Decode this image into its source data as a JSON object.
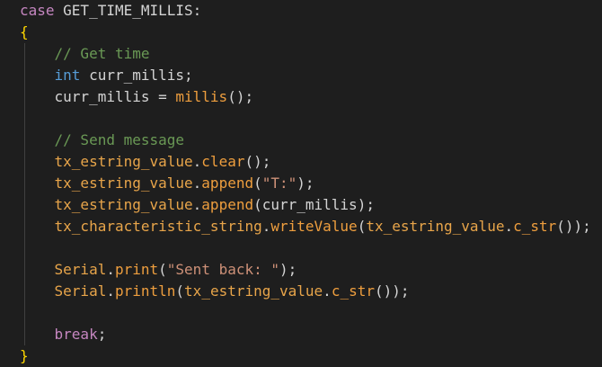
{
  "colors": {
    "background": "#1e1e1e",
    "keyword": "#569cd6",
    "control_keyword": "#c586c0",
    "variable": "#9cdcfe",
    "member_variable": "#e8a54a",
    "function": "#dcdcaa",
    "orange_function": "#ee9e3e",
    "string": "#ce9178",
    "comment": "#6a9955",
    "punctuation": "#d4d4d4",
    "brace": "#ffd700",
    "paren": "#da70d6",
    "indent_guide": "#404040"
  },
  "code": {
    "lines": [
      {
        "tokens": [
          {
            "text": "case",
            "kind": "control_keyword"
          },
          {
            "text": " GET_TIME_MILLIS:",
            "kind": "punctuation"
          }
        ]
      },
      {
        "tokens": [
          {
            "text": "{",
            "kind": "brace"
          }
        ]
      },
      {
        "tokens": [
          {
            "text": "    ",
            "kind": "punctuation"
          },
          {
            "text": "// Get time",
            "kind": "comment"
          }
        ]
      },
      {
        "tokens": [
          {
            "text": "    ",
            "kind": "punctuation"
          },
          {
            "text": "int",
            "kind": "keyword"
          },
          {
            "text": " curr_millis;",
            "kind": "punctuation"
          }
        ]
      },
      {
        "tokens": [
          {
            "text": "    curr_millis = ",
            "kind": "punctuation"
          },
          {
            "text": "millis",
            "kind": "orange_function"
          },
          {
            "text": "();",
            "kind": "punctuation"
          }
        ]
      },
      {
        "tokens": []
      },
      {
        "tokens": [
          {
            "text": "    ",
            "kind": "punctuation"
          },
          {
            "text": "// Send message",
            "kind": "comment"
          }
        ]
      },
      {
        "tokens": [
          {
            "text": "    ",
            "kind": "punctuation"
          },
          {
            "text": "tx_estring_value",
            "kind": "member_variable"
          },
          {
            "text": ".",
            "kind": "punctuation"
          },
          {
            "text": "clear",
            "kind": "orange_function"
          },
          {
            "text": "();",
            "kind": "punctuation"
          }
        ]
      },
      {
        "tokens": [
          {
            "text": "    ",
            "kind": "punctuation"
          },
          {
            "text": "tx_estring_value",
            "kind": "member_variable"
          },
          {
            "text": ".",
            "kind": "punctuation"
          },
          {
            "text": "append",
            "kind": "orange_function"
          },
          {
            "text": "(",
            "kind": "punctuation"
          },
          {
            "text": "\"T:\"",
            "kind": "string"
          },
          {
            "text": ");",
            "kind": "punctuation"
          }
        ]
      },
      {
        "tokens": [
          {
            "text": "    ",
            "kind": "punctuation"
          },
          {
            "text": "tx_estring_value",
            "kind": "member_variable"
          },
          {
            "text": ".",
            "kind": "punctuation"
          },
          {
            "text": "append",
            "kind": "orange_function"
          },
          {
            "text": "(curr_millis);",
            "kind": "punctuation"
          }
        ]
      },
      {
        "tokens": [
          {
            "text": "    ",
            "kind": "punctuation"
          },
          {
            "text": "tx_characteristic_string",
            "kind": "member_variable"
          },
          {
            "text": ".",
            "kind": "punctuation"
          },
          {
            "text": "writeValue",
            "kind": "orange_function"
          },
          {
            "text": "(",
            "kind": "punctuation"
          },
          {
            "text": "tx_estring_value",
            "kind": "member_variable"
          },
          {
            "text": ".",
            "kind": "punctuation"
          },
          {
            "text": "c_str",
            "kind": "orange_function"
          },
          {
            "text": "());",
            "kind": "punctuation"
          }
        ]
      },
      {
        "tokens": []
      },
      {
        "tokens": [
          {
            "text": "    ",
            "kind": "punctuation"
          },
          {
            "text": "Serial",
            "kind": "member_variable"
          },
          {
            "text": ".",
            "kind": "punctuation"
          },
          {
            "text": "print",
            "kind": "orange_function"
          },
          {
            "text": "(",
            "kind": "punctuation"
          },
          {
            "text": "\"Sent back: \"",
            "kind": "string"
          },
          {
            "text": ");",
            "kind": "punctuation"
          }
        ]
      },
      {
        "tokens": [
          {
            "text": "    ",
            "kind": "punctuation"
          },
          {
            "text": "Serial",
            "kind": "member_variable"
          },
          {
            "text": ".",
            "kind": "punctuation"
          },
          {
            "text": "println",
            "kind": "orange_function"
          },
          {
            "text": "(",
            "kind": "punctuation"
          },
          {
            "text": "tx_estring_value",
            "kind": "member_variable"
          },
          {
            "text": ".",
            "kind": "punctuation"
          },
          {
            "text": "c_str",
            "kind": "orange_function"
          },
          {
            "text": "());",
            "kind": "punctuation"
          }
        ]
      },
      {
        "tokens": []
      },
      {
        "tokens": [
          {
            "text": "    ",
            "kind": "punctuation"
          },
          {
            "text": "break",
            "kind": "control_keyword"
          },
          {
            "text": ";",
            "kind": "punctuation"
          }
        ]
      },
      {
        "tokens": [
          {
            "text": "}",
            "kind": "brace"
          }
        ]
      }
    ]
  }
}
